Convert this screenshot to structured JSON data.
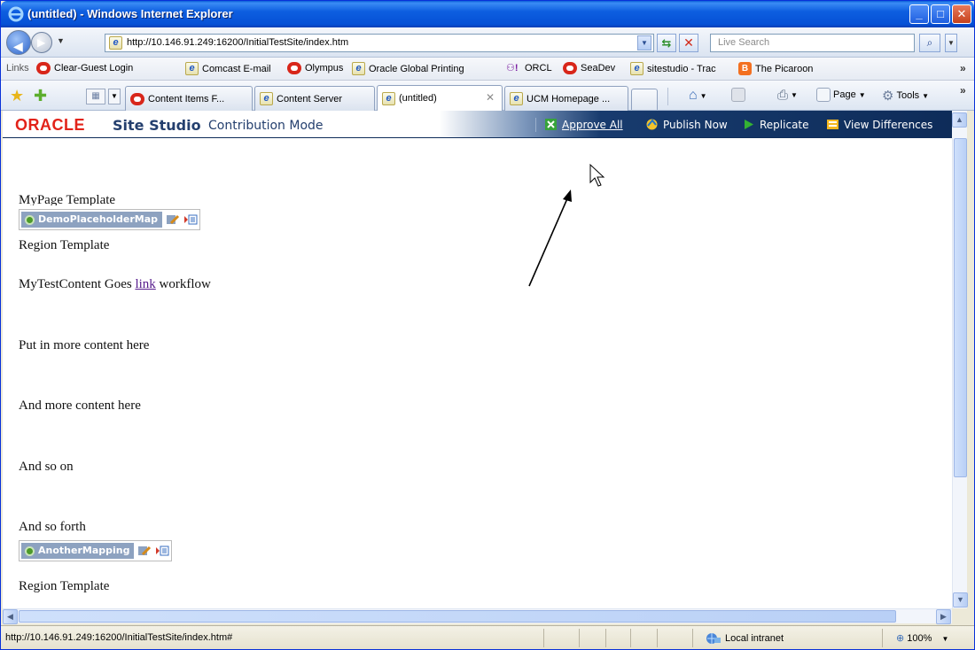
{
  "window": {
    "title": "(untitled) - Windows Internet Explorer",
    "min_glyph": "_",
    "max_glyph": "□",
    "close_glyph": "✕"
  },
  "addressbar": {
    "url": "http://10.146.91.249:16200/InitialTestSite/index.htm",
    "search_placeholder": "Live Search"
  },
  "links": {
    "label": "Links",
    "items": [
      "Clear-Guest Login",
      "Comcast E-mail",
      "Olympus",
      "Oracle Global Printing",
      "ORCL",
      "SeaDev",
      "sitestudio - Trac",
      "The Picaroon"
    ]
  },
  "tabs": [
    {
      "label": "Content Items F..."
    },
    {
      "label": "Content Server"
    },
    {
      "label": "(untitled)"
    },
    {
      "label": "UCM Homepage ..."
    }
  ],
  "commandbar": {
    "page_label": "Page",
    "tools_label": "Tools"
  },
  "sitestudio": {
    "brand": "ORACLE",
    "product": "Site Studio",
    "mode": "Contribution Mode",
    "actions": [
      "Approve All",
      "Publish Now",
      "Replicate",
      "View Differences"
    ]
  },
  "page": {
    "line1": "MyPage Template",
    "region1_label": "DemoPlaceholderMap",
    "region_template_1": "Region Template",
    "content_before": "MyTestContent Goes ",
    "content_link": "link",
    "content_after": " workflow",
    "p1": "Put in more content here",
    "p2": "And more content here",
    "p3": "And so on",
    "p4": "And so forth",
    "region2_label": "AnotherMapping",
    "region_template_2": "Region Template"
  },
  "statusbar": {
    "url": "http://10.146.91.249:16200/InitialTestSite/index.htm#",
    "zone": "Local intranet",
    "zoom": "100%"
  },
  "colors": {
    "oracle_red": "#e2231a",
    "header_navy": "#0e2c59",
    "region_chip": "#8da2c0",
    "visited_link": "#551a8b"
  }
}
